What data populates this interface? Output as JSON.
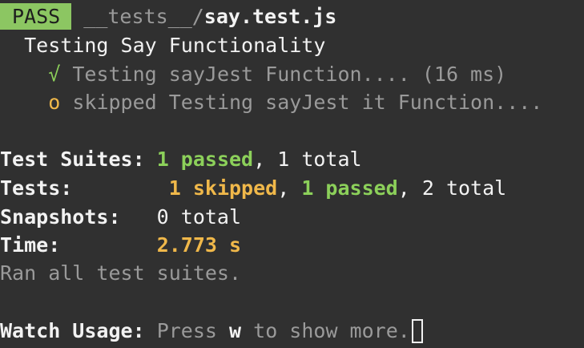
{
  "header": {
    "badge": "PASS",
    "dir": "__tests__/",
    "file": "say.test.js"
  },
  "suite": {
    "title": "Testing Say Functionality",
    "tests": [
      {
        "status_icon": "check-icon",
        "symbol": "√",
        "status": "passed",
        "name": "Testing sayJest Function....",
        "duration": "(16 ms)"
      },
      {
        "status_icon": "circle-icon",
        "symbol": "o",
        "status": "skipped",
        "name": "skipped Testing sayJest it Function...."
      }
    ]
  },
  "summary": {
    "suites": {
      "label": "Test Suites:",
      "passed": "1 passed",
      "total": "1 total"
    },
    "tests": {
      "label": "Tests:",
      "skipped": "1 skipped",
      "passed": "1 passed",
      "total": "2 total"
    },
    "snapshots": {
      "label": "Snapshots:",
      "total": "0 total"
    },
    "time": {
      "label": "Time:",
      "value": "2.773 s"
    },
    "ran": "Ran all test suites."
  },
  "watch": {
    "label": "Watch Usage:",
    "press": "Press",
    "key": "w",
    "rest": "to show more."
  },
  "colors": {
    "background": "#303030",
    "pass_badge": "#8cc662",
    "green": "#8cd05a",
    "yellow": "#f0b84a",
    "dim": "#9a9a9a"
  }
}
